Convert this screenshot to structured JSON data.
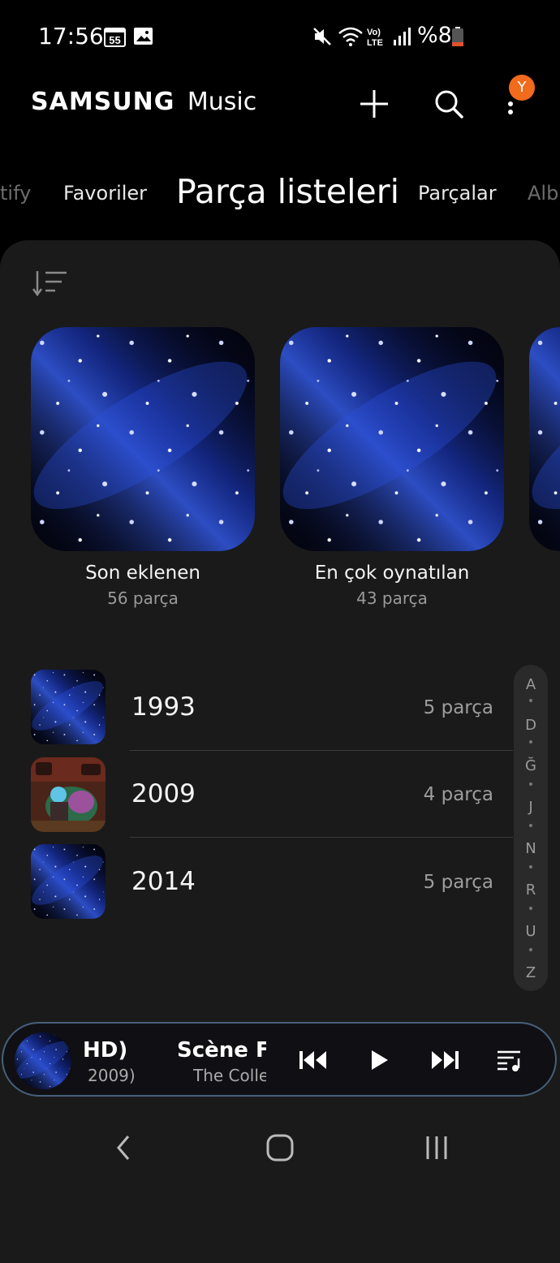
{
  "status_bar": {
    "time": "17:56",
    "notification_badge": "55",
    "battery_text": "%8",
    "icons": [
      "calendar-icon",
      "image-icon",
      "mute-icon",
      "wifi-icon",
      "volte-icon",
      "signal-icon",
      "battery-icon"
    ]
  },
  "header": {
    "brand": "SAMSUNG",
    "app_name": "Music",
    "avatar_letter": "Y",
    "accent": "#f26a1b"
  },
  "tabs": [
    {
      "label": "tify",
      "state": "partial"
    },
    {
      "label": "Favoriler",
      "state": "normal"
    },
    {
      "label": "Parça listeleri",
      "state": "active"
    },
    {
      "label": "Parçalar",
      "state": "normal"
    },
    {
      "label": "Alb",
      "state": "partial"
    }
  ],
  "featured": [
    {
      "title": "Son eklenen",
      "count": "56 parça"
    },
    {
      "title": "En çok oynatılan",
      "count": "43 parça"
    }
  ],
  "playlists": [
    {
      "title": "1993",
      "count": "5 parça",
      "art": "galaxy"
    },
    {
      "title": "2009",
      "count": "4 parça",
      "art": "album"
    },
    {
      "title": "2014",
      "count": "5 parça",
      "art": "galaxy"
    }
  ],
  "index_letters": [
    "A",
    "D",
    "Ğ",
    "J",
    "N",
    "R",
    "U",
    "Z"
  ],
  "mini_player": {
    "left_title": "HD)",
    "left_sub": "2009)",
    "title": "Scène Fi",
    "subtitle": "The Colle"
  }
}
